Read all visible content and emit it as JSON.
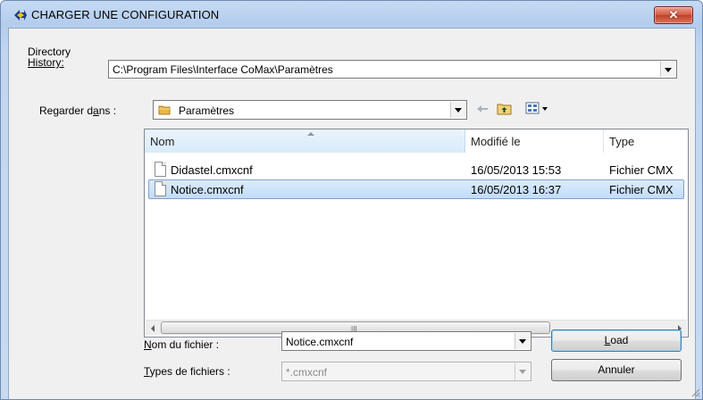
{
  "window": {
    "title": "CHARGER UNE CONFIGURATION",
    "close_label": "✕",
    "colors": {
      "title_bar": "#b4cdee",
      "close": "#c2402a",
      "selection": "#c1dcfb"
    }
  },
  "directory_history": {
    "label_line1": "Directory",
    "label_line2": "History:",
    "value": "C:\\Program Files\\Interface CoMax\\Paramètres"
  },
  "look_in": {
    "label": "Regarder dans :",
    "value": "Paramètres",
    "icons": [
      "back-arrow-icon",
      "up-folder-icon",
      "view-menu-icon"
    ]
  },
  "file_list": {
    "columns": [
      {
        "label": "Nom"
      },
      {
        "label": "Modifié le"
      },
      {
        "label": "Type"
      }
    ],
    "rows": [
      {
        "name": "Didastel.cmxcnf",
        "modified": "16/05/2013 15:53",
        "type": "Fichier CMX"
      },
      {
        "name": "Notice.cmxcnf",
        "modified": "16/05/2013 16:37",
        "type": "Fichier CMX"
      }
    ],
    "selected_row": 2,
    "scroll_grip": "III"
  },
  "file_name": {
    "label": "Nom du fichier :",
    "value": "Notice.cmxcnf"
  },
  "file_types": {
    "label": "Types de fichiers :",
    "value": "*.cmxcnf"
  },
  "buttons": {
    "load": "Load",
    "cancel": "Annuler"
  }
}
